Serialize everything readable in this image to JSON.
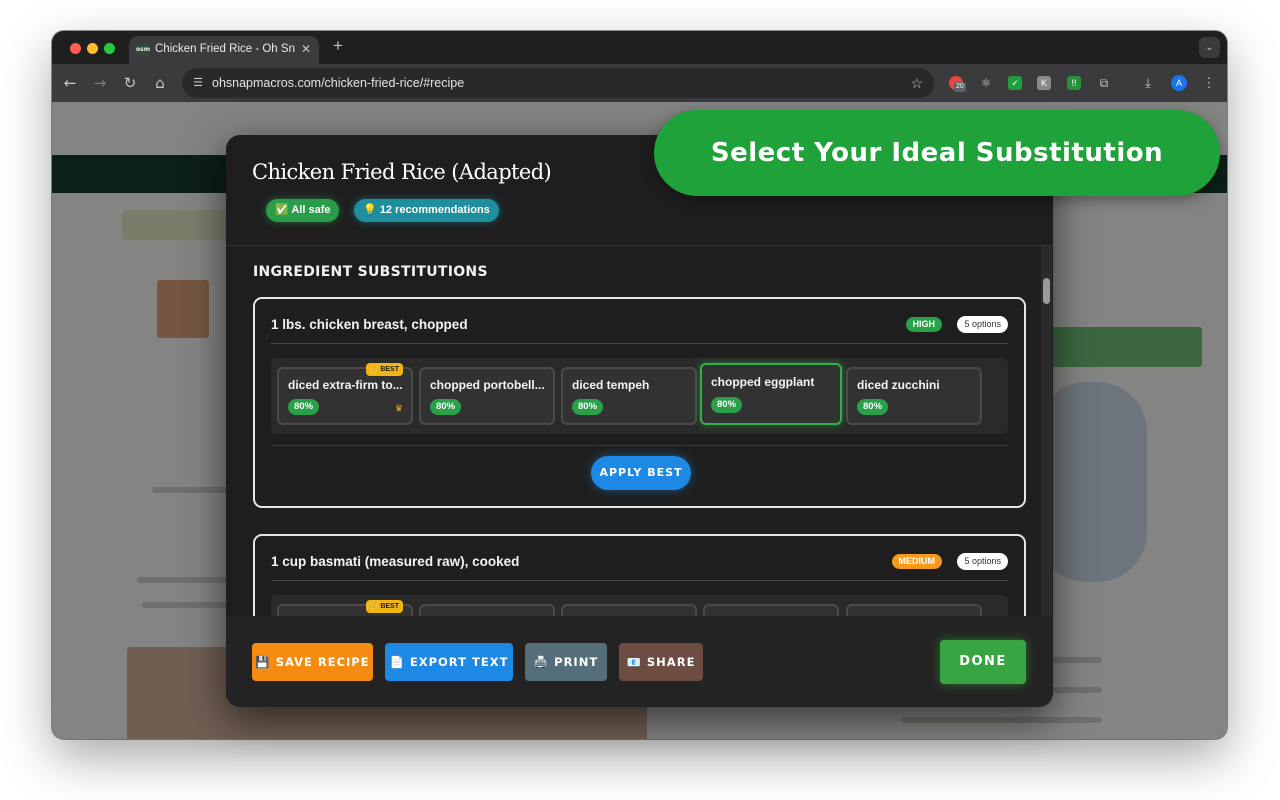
{
  "browser": {
    "tab_title": "Chicken Fried Rice - Oh Snap",
    "tab_close": "✕",
    "new_tab": "+",
    "favicon_text": "osm",
    "url": "ohsnapmacros.com/chicken-fried-rice/#recipe",
    "extension_badge": "20",
    "profile_initial": "A"
  },
  "banner": {
    "text": "Select Your Ideal Substitution"
  },
  "modal": {
    "title": "Chicken Fried Rice (Adapted)",
    "safe_pill": "✅ All safe",
    "rec_pill": "💡 12 recommendations",
    "section_heading": "INGREDIENT SUBSTITUTIONS",
    "ingredients": [
      {
        "title": "1 lbs. chicken breast, chopped",
        "priority": "HIGH",
        "priority_color": "#2aa04a",
        "options_count": "5 options",
        "best_label": "👑 BEST",
        "apply_label": "APPLY BEST",
        "options": [
          {
            "name": "diced extra-firm to...",
            "match": "80%"
          },
          {
            "name": "chopped portobell...",
            "match": "80%"
          },
          {
            "name": "diced tempeh",
            "match": "80%"
          },
          {
            "name": "chopped eggplant",
            "match": "80%"
          },
          {
            "name": "diced zucchini",
            "match": "80%"
          }
        ]
      },
      {
        "title": "1 cup  basmati (measured raw), cooked",
        "priority": "MEDIUM",
        "priority_color": "#f59a1b",
        "options_count": "5 options",
        "best_label": "👑 BEST"
      }
    ]
  },
  "footer": {
    "save": "💾 SAVE RECIPE",
    "export": "📄 EXPORT TEXT",
    "print": "🖨️ PRINT",
    "share": "📧 SHARE",
    "done": "DONE"
  },
  "colors": {
    "save": "#f68b12",
    "export": "#1e88e5",
    "print": "#546e7a",
    "share": "#6d4c41",
    "done": "#38a543",
    "banner": "#1fa23a"
  }
}
